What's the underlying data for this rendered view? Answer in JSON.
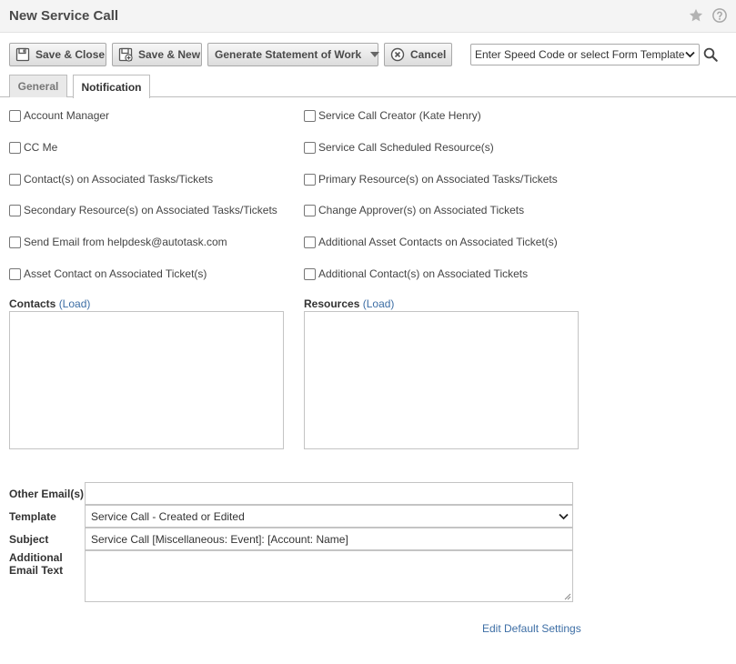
{
  "header": {
    "title": "New Service Call"
  },
  "toolbar": {
    "save_close": "Save & Close",
    "save_new": "Save & New",
    "generate_sow": "Generate Statement of Work",
    "cancel": "Cancel",
    "speed_code_placeholder": "Enter Speed Code or select Form Template"
  },
  "tabs": [
    {
      "label": "General",
      "active": false
    },
    {
      "label": "Notification",
      "active": true
    }
  ],
  "checkboxes": {
    "left": [
      {
        "label": "Account Manager",
        "checked": false
      },
      {
        "label": "CC Me",
        "checked": false
      },
      {
        "label": "Contact(s) on Associated Tasks/Tickets",
        "checked": false
      },
      {
        "label": "Secondary Resource(s) on Associated Tasks/Tickets",
        "checked": false
      },
      {
        "label": "Send Email from helpdesk@autotask.com",
        "checked": false
      },
      {
        "label": "Asset Contact on Associated Ticket(s)",
        "checked": false
      }
    ],
    "right": [
      {
        "label": "Service Call Creator (Kate Henry)",
        "checked": false
      },
      {
        "label": "Service Call Scheduled Resource(s)",
        "checked": false
      },
      {
        "label": "Primary Resource(s) on Associated Tasks/Tickets",
        "checked": false
      },
      {
        "label": "Change Approver(s) on Associated Tickets",
        "checked": false
      },
      {
        "label": "Additional Asset Contacts on Associated Ticket(s)",
        "checked": false
      },
      {
        "label": "Additional Contact(s) on Associated Tickets",
        "checked": false
      }
    ]
  },
  "contacts": {
    "label": "Contacts",
    "load": "(Load)"
  },
  "resources": {
    "label": "Resources",
    "load": "(Load)"
  },
  "form": {
    "other_emails_label": "Other Email(s)",
    "other_emails_value": "",
    "template_label": "Template",
    "template_value": "Service Call - Created or Edited",
    "subject_label": "Subject",
    "subject_value": "Service Call [Miscellaneous: Event]: [Account: Name]",
    "additional_label_line1": "Additional",
    "additional_label_line2": "Email Text",
    "additional_value": ""
  },
  "footer": {
    "edit_defaults": "Edit Default Settings"
  },
  "colors": {
    "link": "#3d6ea5",
    "title": "#4a4a4a"
  }
}
